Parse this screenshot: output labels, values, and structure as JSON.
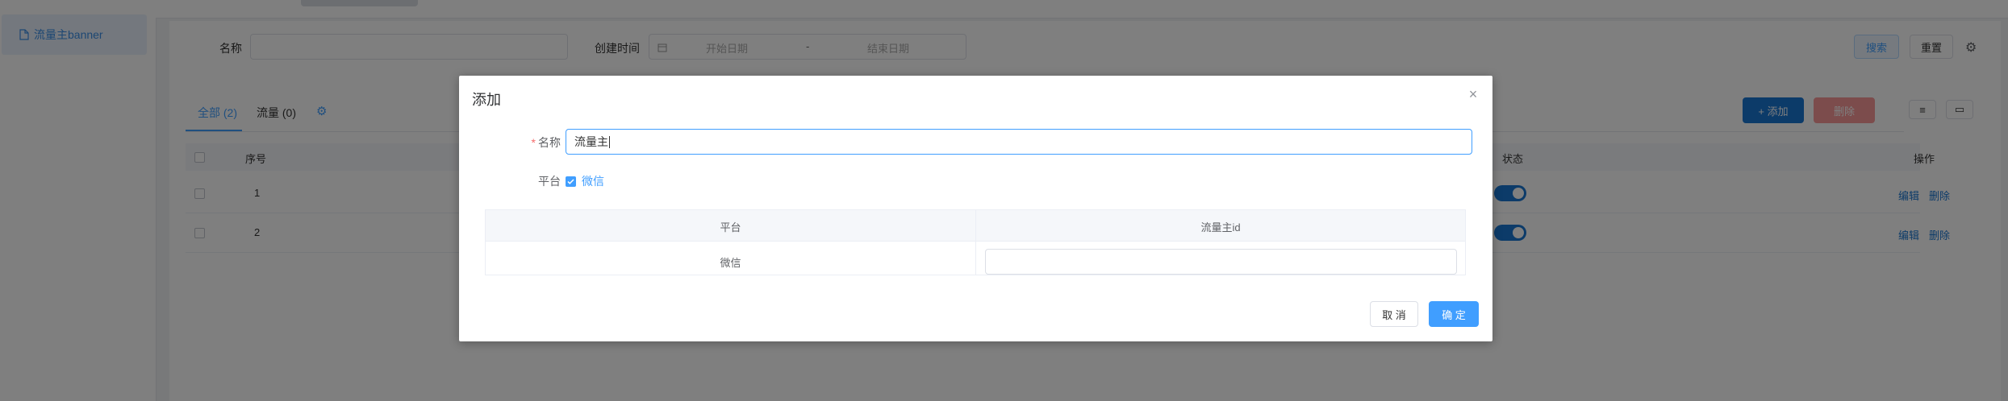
{
  "sidebar": {
    "items": [
      {
        "label": "流量主banner",
        "icon": "document-icon"
      }
    ]
  },
  "filter": {
    "name_label": "名称",
    "name_value": "",
    "created_label": "创建时间",
    "start_placeholder": "开始日期",
    "range_sep": "-",
    "end_placeholder": "结束日期",
    "search_label": "搜索",
    "reset_label": "重置"
  },
  "tabs": [
    {
      "label": "全部 (2)"
    },
    {
      "label": "流量 (0)"
    }
  ],
  "toolbar": {
    "add_label": "+ 添加",
    "delete_label": "删除"
  },
  "table": {
    "columns": [
      "序号",
      "状态",
      "操作"
    ],
    "rows": [
      {
        "index": "1",
        "status_on": true,
        "actions": [
          "编辑",
          "删除"
        ]
      },
      {
        "index": "2",
        "status_on": true,
        "actions": [
          "编辑",
          "删除"
        ]
      }
    ]
  },
  "dialog": {
    "title": "添加",
    "name_label": "名称",
    "name_value": "流量主",
    "platform_label": "平台",
    "platform_option": "微信",
    "platform_checked": true,
    "inner_table": {
      "headers": [
        "平台",
        "流量主id"
      ],
      "rows": [
        {
          "platform": "微信",
          "id_value": ""
        }
      ]
    },
    "cancel_label": "取 消",
    "ok_label": "确 定"
  },
  "colors": {
    "primary": "#409eff",
    "danger": "#f56c6c",
    "accent": "#1976d2"
  }
}
